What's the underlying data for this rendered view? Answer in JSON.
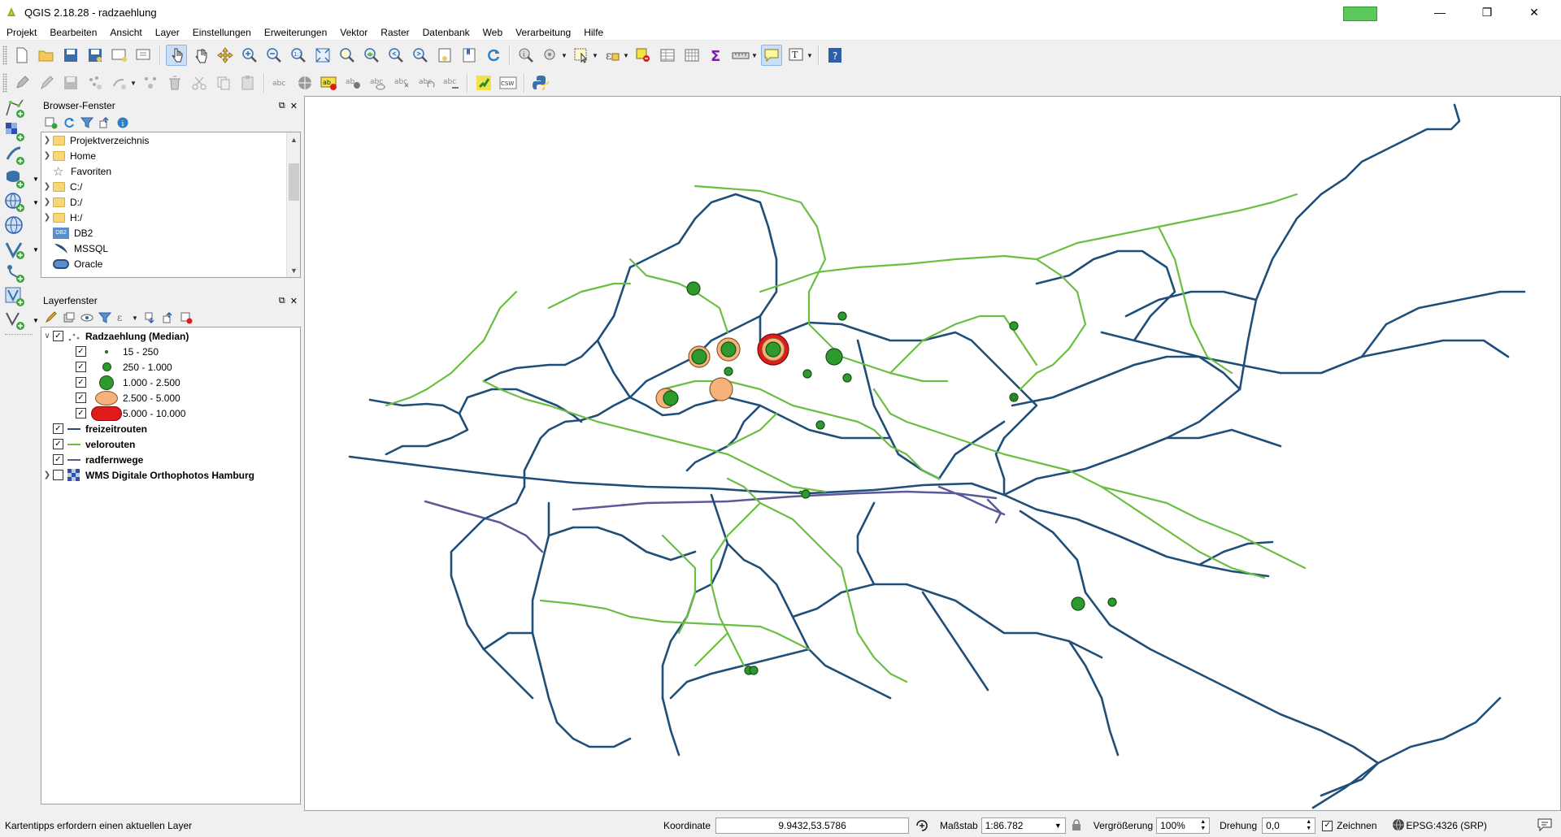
{
  "window": {
    "title": "QGIS 2.18.28 - radzaehlung"
  },
  "menu": [
    "Projekt",
    "Bearbeiten",
    "Ansicht",
    "Layer",
    "Einstellungen",
    "Erweiterungen",
    "Vektor",
    "Raster",
    "Datenbank",
    "Web",
    "Verarbeitung",
    "Hilfe"
  ],
  "browser": {
    "title": "Browser-Fenster",
    "items": [
      {
        "label": "Projektverzeichnis",
        "icon": "folder-icon",
        "expandable": true
      },
      {
        "label": "Home",
        "icon": "folder-icon",
        "expandable": true
      },
      {
        "label": "Favoriten",
        "icon": "star-icon",
        "expandable": false
      },
      {
        "label": "C:/",
        "icon": "folder-icon",
        "expandable": true
      },
      {
        "label": "D:/",
        "icon": "folder-icon",
        "expandable": true
      },
      {
        "label": "H:/",
        "icon": "folder-icon",
        "expandable": true
      },
      {
        "label": "DB2",
        "icon": "db2-icon",
        "expandable": false
      },
      {
        "label": "MSSQL",
        "icon": "mssql-icon",
        "expandable": false
      },
      {
        "label": "Oracle",
        "icon": "oracle-icon",
        "expandable": false
      }
    ]
  },
  "layers": {
    "title": "Layerfenster",
    "root": {
      "name": "Radzaehlung (Median)",
      "checked": true,
      "classes": [
        {
          "label": "15 - 250",
          "color": "#2e9a2e",
          "size": "tiny"
        },
        {
          "label": "250 - 1.000",
          "color": "#2e9a2e",
          "size": "small"
        },
        {
          "label": "1.000 - 2.500",
          "color": "#2e9a2e",
          "size": "medium"
        },
        {
          "label": "2.500 - 5.000",
          "color": "#f6b27a",
          "size": "large"
        },
        {
          "label": "5.000 - 10.000",
          "color": "#e31a1c",
          "size": "xlarge"
        }
      ]
    },
    "lines": [
      {
        "name": "freizeitrouten",
        "color": "#1f4e79",
        "checked": true
      },
      {
        "name": "velorouten",
        "color": "#6abf40",
        "checked": true
      },
      {
        "name": "radfernwege",
        "color": "#5a5a9a",
        "checked": true
      }
    ],
    "wms": {
      "name": "WMS Digitale Orthophotos Hamburg",
      "checked": false
    }
  },
  "status": {
    "message": "Kartentipps erfordern einen aktuellen Layer",
    "coord_label": "Koordinate",
    "coord_value": "9.9432,53.5786",
    "scale_label": "Maßstab",
    "scale_value": "1:86.782",
    "zoom_label": "Vergrößerung",
    "zoom_value": "100%",
    "rotation_label": "Drehung",
    "rotation_value": "0,0",
    "render_label": "Zeichnen",
    "render_checked": true,
    "crs": "EPSG:4326 (SRP)"
  }
}
